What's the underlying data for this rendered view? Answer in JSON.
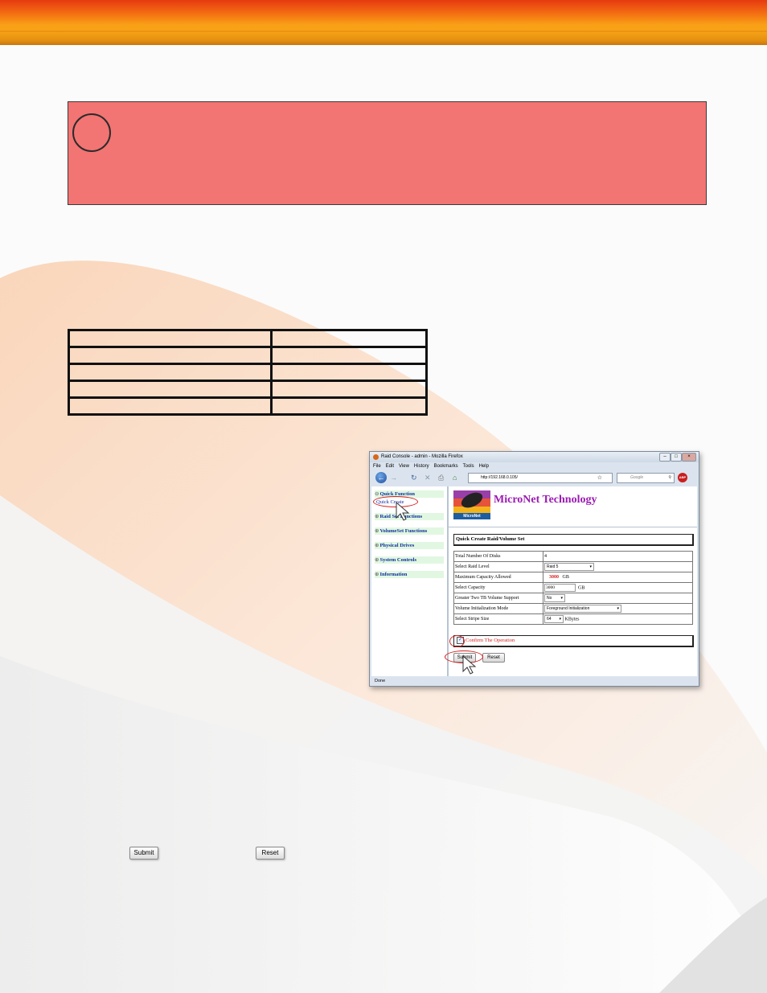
{
  "browser": {
    "title": "Raid Console - admin - Mozilla Firefox",
    "menu": [
      "File",
      "Edit",
      "View",
      "History",
      "Bookmarks",
      "Tools",
      "Help"
    ],
    "url": "http://192.168.0.105/",
    "search_placeholder": "Google",
    "addon_badge": "ABP",
    "status": "Done"
  },
  "sidebar": {
    "quick_function": "Quick Function",
    "quick_create": "Quick Create",
    "items": [
      "Raid Set Functions",
      "VolumeSet Functions",
      "Physical Drives",
      "System Controls",
      "Information"
    ]
  },
  "brand": {
    "logo_text": "MicroNet",
    "name": "MicroNet Technology"
  },
  "form": {
    "title": "Quick Create Raid/Volume Set",
    "rows": [
      {
        "label": "Total Number Of Disks",
        "value": "4"
      },
      {
        "label": "Select Raid Level",
        "value": "Raid 5"
      },
      {
        "label": "Maximum Capacity Allowed",
        "value": "3000",
        "unit": "GB"
      },
      {
        "label": "Select Capacity",
        "value": "3000",
        "unit": "GB"
      },
      {
        "label": "Greater Two TB Volume Support",
        "value": "No"
      },
      {
        "label": "Volume Initialization Mode",
        "value": "Foreground Initialization"
      },
      {
        "label": "Select Stripe Size",
        "value": "64",
        "unit": "KBytes"
      }
    ],
    "confirm_label": "Confirm The Operation",
    "confirm_checked": true,
    "submit": "Submit",
    "reset": "Reset"
  },
  "page_buttons": {
    "submit": "Submit",
    "reset": "Reset"
  },
  "colors": {
    "warning_box": "#f27473",
    "sidebar_green": "#e1f7e1",
    "sidebar_text": "#0f2f9e",
    "brand_purple": "#9b1ab3",
    "highlight_red": "#d62020"
  }
}
